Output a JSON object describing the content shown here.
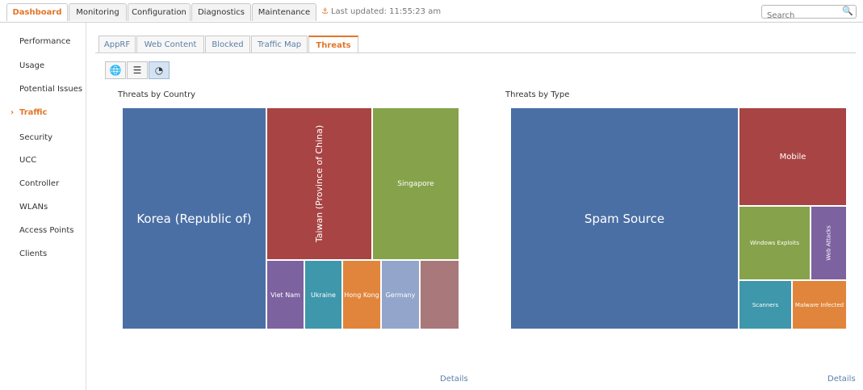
{
  "nav": {
    "tabs": [
      "Dashboard",
      "Monitoring",
      "Configuration",
      "Diagnostics",
      "Maintenance"
    ],
    "last_updated": "Last updated: 11:55:23 am",
    "search_placeholder": "Search"
  },
  "sidebar": {
    "items": [
      "Performance",
      "Usage",
      "Potential Issues",
      "Traffic",
      "Security",
      "UCC",
      "Controller",
      "WLANs",
      "Access Points",
      "Clients"
    ],
    "active": "Traffic"
  },
  "subtabs": {
    "items": [
      "AppRF",
      "Web Content",
      "Blocked",
      "Traffic Map",
      "Threats"
    ],
    "active": "Threats"
  },
  "view_toggle": {
    "buttons": [
      "globe-icon",
      "list-icon",
      "chart-icon"
    ],
    "active": "chart-icon"
  },
  "chart_data": [
    {
      "type": "treemap",
      "title": "Threats by Country",
      "categories": [
        "Korea (Republic of)",
        "Taiwan (Province of China)",
        "Singapore",
        "Viet Nam",
        "Ukraine",
        "Hong Kong",
        "Germany",
        ""
      ],
      "colors": [
        "#4a6fa5",
        "#a94444",
        "#86a24a",
        "#7d62a0",
        "#3e97ab",
        "#e0853b",
        "#93a5cb",
        "#a8787a"
      ]
    },
    {
      "type": "treemap",
      "title": "Threats by Type",
      "categories": [
        "Spam Source",
        "Mobile",
        "Windows Exploits",
        "Web Attacks",
        "Scanners",
        "Malware Infected"
      ],
      "colors": [
        "#4a6fa5",
        "#a94444",
        "#86a24a",
        "#7d62a0",
        "#3e97ab",
        "#e0853b"
      ]
    }
  ],
  "details_label": "Details"
}
